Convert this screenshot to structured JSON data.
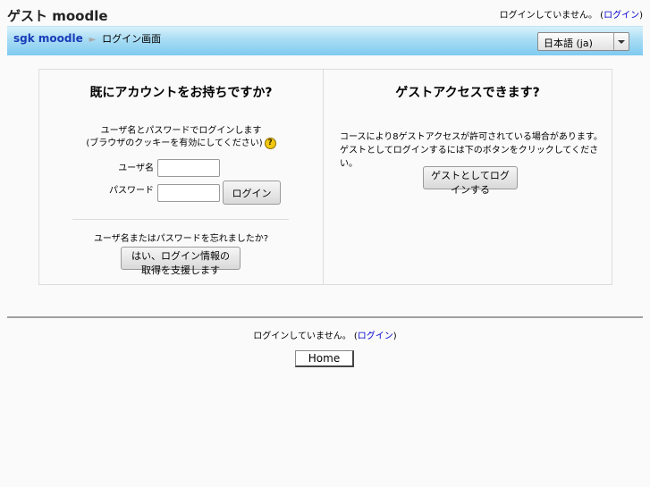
{
  "header": {
    "site_title": "ゲスト moodle",
    "login_status": "ログインしていません。",
    "login_link": "ログイン"
  },
  "navbar": {
    "home_link": "sgk moodle",
    "separator": "►",
    "current": "ログイン画面",
    "language_select": "日本語 (ja)"
  },
  "login": {
    "heading": "既にアカウントをお持ちですか?",
    "description_line1": "ユーザ名とパスワードでログインします",
    "description_line2": "(ブラウザのクッキーを有効にしてください)",
    "help_icon": "help-icon",
    "help_glyph": "?",
    "username_label": "ユーザ名",
    "username_value": "",
    "password_label": "パスワード",
    "password_value": "",
    "login_button": "ログイン",
    "forgot_prompt": "ユーザ名またはパスワードを忘れましたか?",
    "forgot_button": "はい、ログイン情報の取得を支援します"
  },
  "guest": {
    "heading": "ゲストアクセスできます?",
    "description_line1": "コースにより8ゲストアクセスが許可されている場合があります。",
    "description_line2": "ゲストとしてログインするには下のボタンをクリックしてください。",
    "guest_button": "ゲストとしてログインする"
  },
  "footer": {
    "login_status": "ログインしていません。",
    "login_link": "ログイン",
    "home_button": "Home"
  },
  "colors": {
    "navbar_gradient_top": "#d8f1fb",
    "navbar_gradient_bottom": "#7fcaf0",
    "link": "#0000cc",
    "breadcrumb_link": "#1a3cb8"
  }
}
